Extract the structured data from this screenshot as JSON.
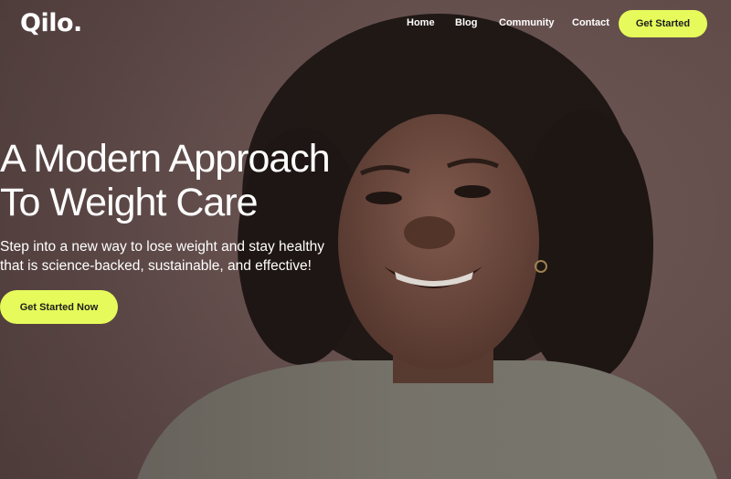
{
  "brand": {
    "logo_text": "Qilo."
  },
  "nav": {
    "links": [
      {
        "label": "Home"
      },
      {
        "label": "Blog"
      },
      {
        "label": "Community"
      },
      {
        "label": "Contact"
      }
    ],
    "cta_label": "Get Started"
  },
  "hero": {
    "title_lines": [
      "A Modern Approach",
      "To Weight Care"
    ],
    "subtitle_lines": [
      "Step into a new way to lose weight and stay healthy",
      "that is science-backed, sustainable, and effective!"
    ],
    "cta_label": "Get Started Now",
    "background_image": "smiling-woman-portrait"
  },
  "colors": {
    "accent": "#e6fb5b",
    "background": "#6d5654",
    "text": "#ffffff"
  }
}
